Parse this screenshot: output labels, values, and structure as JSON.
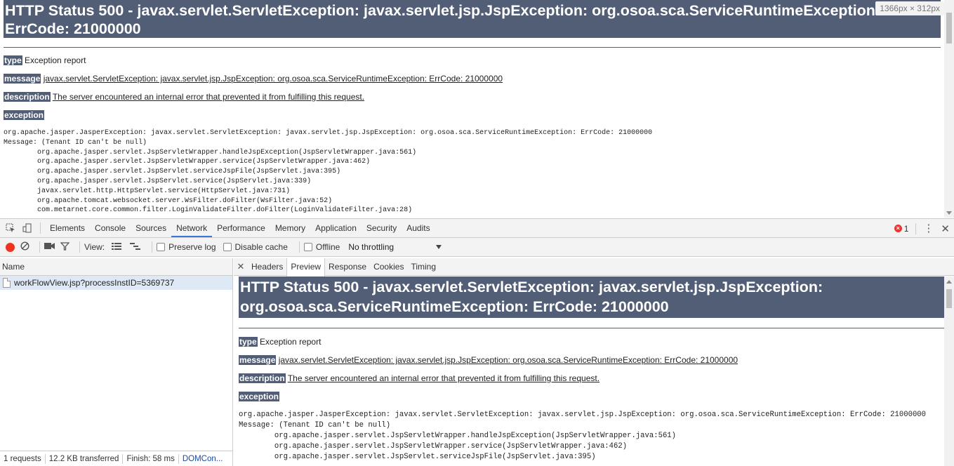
{
  "page": {
    "title": "HTTP Status 500 - javax.servlet.ServletException: javax.servlet.jsp.JspException: org.osoa.sca.ServiceRuntimeException: ErrCode: 21000000",
    "type_label": "type",
    "type_value": "Exception report",
    "message_label": "message",
    "message_value": "javax.servlet.ServletException: javax.servlet.jsp.JspException: org.osoa.sca.ServiceRuntimeException: ErrCode: 21000000",
    "description_label": "description",
    "description_value": "The server encountered an internal error that prevented it from fulfilling this request.",
    "exception_label": "exception",
    "stack": "org.apache.jasper.JasperException: javax.servlet.ServletException: javax.servlet.jsp.JspException: org.osoa.sca.ServiceRuntimeException: ErrCode: 21000000\nMessage: (Tenant ID can't be null)\n\torg.apache.jasper.servlet.JspServletWrapper.handleJspException(JspServletWrapper.java:561)\n\torg.apache.jasper.servlet.JspServletWrapper.service(JspServletWrapper.java:462)\n\torg.apache.jasper.servlet.JspServlet.serviceJspFile(JspServlet.java:395)\n\torg.apache.jasper.servlet.JspServlet.service(JspServlet.java:339)\n\tjavax.servlet.http.HttpServlet.service(HttpServlet.java:731)\n\torg.apache.tomcat.websocket.server.WsFilter.doFilter(WsFilter.java:52)\n\tcom.metarnet.core.common.filter.LoginValidateFilter.doFilter(LoginValidateFilter.java:28)",
    "size_badge": "1366px × 312px"
  },
  "devtools": {
    "tabs": [
      "Elements",
      "Console",
      "Sources",
      "Network",
      "Performance",
      "Memory",
      "Application",
      "Security",
      "Audits"
    ],
    "active_tab": "Network",
    "error_count": "1",
    "toolbar": {
      "view_label": "View:",
      "preserve_log": "Preserve log",
      "disable_cache": "Disable cache",
      "offline": "Offline",
      "throttling": "No throttling"
    },
    "name_header": "Name",
    "request": "workFlowView.jsp?processInstID=5369737",
    "status": {
      "requests": "1 requests",
      "transferred": "12.2 KB transferred",
      "finish": "Finish: 58 ms",
      "domcontent": "DOMCon..."
    },
    "subtabs": [
      "Headers",
      "Preview",
      "Response",
      "Cookies",
      "Timing"
    ],
    "active_subtab": "Preview",
    "preview": {
      "title": "HTTP Status 500 - javax.servlet.ServletException: javax.servlet.jsp.JspException: org.osoa.sca.ServiceRuntimeException: ErrCode: 21000000",
      "stack": "org.apache.jasper.JasperException: javax.servlet.ServletException: javax.servlet.jsp.JspException: org.osoa.sca.ServiceRuntimeException: ErrCode: 21000000\nMessage: (Tenant ID can't be null)\n\torg.apache.jasper.servlet.JspServletWrapper.handleJspException(JspServletWrapper.java:561)\n\torg.apache.jasper.servlet.JspServletWrapper.service(JspServletWrapper.java:462)\n\torg.apache.jasper.servlet.JspServlet.serviceJspFile(JspServlet.java:395)"
    }
  }
}
